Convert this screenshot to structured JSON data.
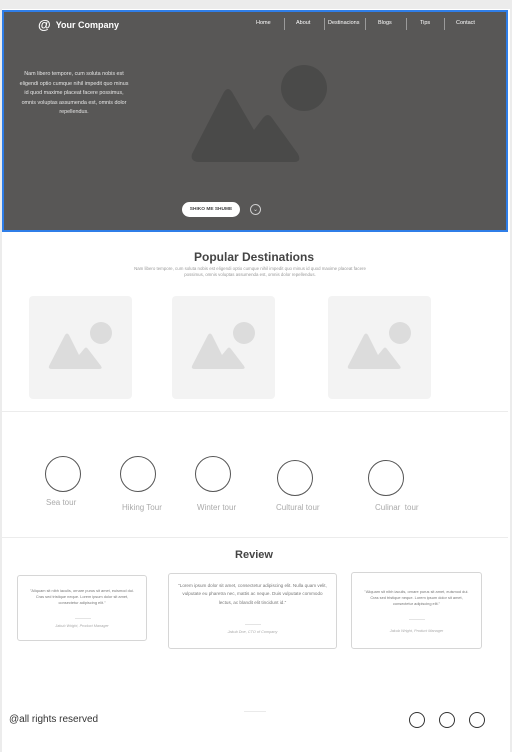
{
  "header": {
    "logo_icon": "@",
    "company_name": "Your Company",
    "nav": [
      "Home",
      "About",
      "Destinacions",
      "Blogs",
      "Tips",
      "Contact"
    ]
  },
  "hero": {
    "text": "Nam libero tempore, cum soluta nobis est eligendi optio cumque nihil impedit quo minus id quod maxime placeat facere possimus, omnis voluptas assumenda est, omnis dolor repellendus.",
    "button_label": "SHIKO ME SHUME",
    "image_icon": "image-placeholder-icon"
  },
  "popular": {
    "title": "Popular Destinations",
    "subtitle": "Nam libero tempore, cum soluta nobis est eligendi optio cumque nihil impedit quo minus id quod maxime placeat facere possimus, omnis voluptas assumenda est, omnis dolor repellendus."
  },
  "tours": [
    "Sea tour",
    "Hiking Tour",
    "Winter tour",
    "Cultural tour",
    "Culinar  tour"
  ],
  "reviews": {
    "title": "Review",
    "items": [
      {
        "text": "\"Aliquam sit nibh iaculis, ornare purus sit amet, euismod dui. Cras sed tristique neque. Lorem ipsum dolor sit amet, consectetur adipiscing elit.\"",
        "author": "Jakub Wright, Product Manager"
      },
      {
        "text": "\"Lorem ipsum dolor sit amet, consectetur adipiscing elit. Nulla quam velit, vulputate eu pharetra nec, mattis ac neque. Duis vulputate commodo lectus, ac blandit elit tincidunt id.\"",
        "author": "Jakub Doe, CTO of Company"
      },
      {
        "text": "\"Aliquam sit nibh iaculis, ornare purus sit amet, euismod dui. Cras sed tristique neque. Lorem ipsum dolor sit amet, consectetur adipiscing elit.\"",
        "author": "Jakub Wright, Product Manager"
      }
    ]
  },
  "footer": {
    "copyright": "@all rights reserved"
  },
  "colors": {
    "hero_bg": "#585756",
    "selection_border": "#2f7ee8",
    "placeholder_bg": "#f3f3f3"
  }
}
